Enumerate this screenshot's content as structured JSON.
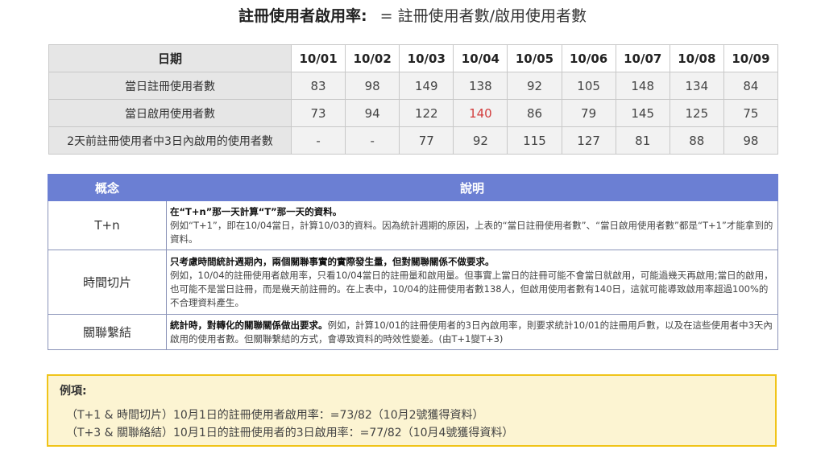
{
  "title": {
    "bold": "註冊使用者啟用率:",
    "rest": "= 註冊使用者數/啟用使用者數"
  },
  "data_table": {
    "header_label": "日期",
    "dates": [
      "10/01",
      "10/02",
      "10/03",
      "10/04",
      "10/05",
      "10/06",
      "10/07",
      "10/08",
      "10/09"
    ],
    "rows": [
      {
        "label": "當日註冊使用者數",
        "values": [
          "83",
          "98",
          "149",
          "138",
          "92",
          "105",
          "148",
          "134",
          "84"
        ]
      },
      {
        "label": "當日啟用使用者數",
        "values": [
          "73",
          "94",
          "122",
          "140",
          "86",
          "79",
          "145",
          "125",
          "75"
        ]
      },
      {
        "label": "2天前註冊使用者中3日內啟用的使用者數",
        "values": [
          "-",
          "-",
          "77",
          "92",
          "115",
          "127",
          "81",
          "88",
          "98"
        ]
      }
    ],
    "highlight_color": "#d23c3c"
  },
  "concept_table": {
    "headers": {
      "concept": "概念",
      "desc": "說明"
    },
    "rows": [
      {
        "term": "T+n",
        "lead": "在“T+n”那一天計算“T”那一天的資料。",
        "body": "例如“T+1”，即在10/04當日，計算10/03的資料。因為統計週期的原因，上表的“當日註冊使用者數”、“當日啟用使用者數”都是“T+1”才能拿到的資料。"
      },
      {
        "term": "時間切片",
        "lead": "只考慮時間統計週期內，兩個關聯事實的實際發生量，但對關聯關係不做要求。",
        "body": "例如，10/04的註冊使用者啟用率，只看10/04當日的註冊量和啟用量。但事實上當日的註冊可能不會當日就啟用，可能過幾天再啟用;當日的啟用，也可能不是當日註冊，而是幾天前註冊的。在上表中，10/04的註冊使用者數138人，但啟用使用者數有140日，這就可能導致啟用率超過100%的不合理資料產生。"
      },
      {
        "term": "關聯繫結",
        "lead": "統計時，對轉化的關聯關係做出要求。",
        "body": "例如，計算10/01的註冊使用者的3日內啟用率，則要求統計10/01的註冊用戶數，以及在這些使用者中3天內啟用的使用者數。但關聯繫結的方式，會導致資料的時效性變差。(由T+1變T+3)"
      }
    ],
    "header_color": "#6b7fd3"
  },
  "example": {
    "title": "例項:",
    "lines": [
      "（T+1 & 時間切片）10月1日的註冊使用者啟用率：=73/82（10月2號獲得資料）",
      "（T+3 & 關聯絡結）10月1日的註冊使用者的3日啟用率：=77/82（10月4號獲得資料）"
    ],
    "bg_color": "#fcf4d2",
    "border_color": "#f0c419"
  }
}
